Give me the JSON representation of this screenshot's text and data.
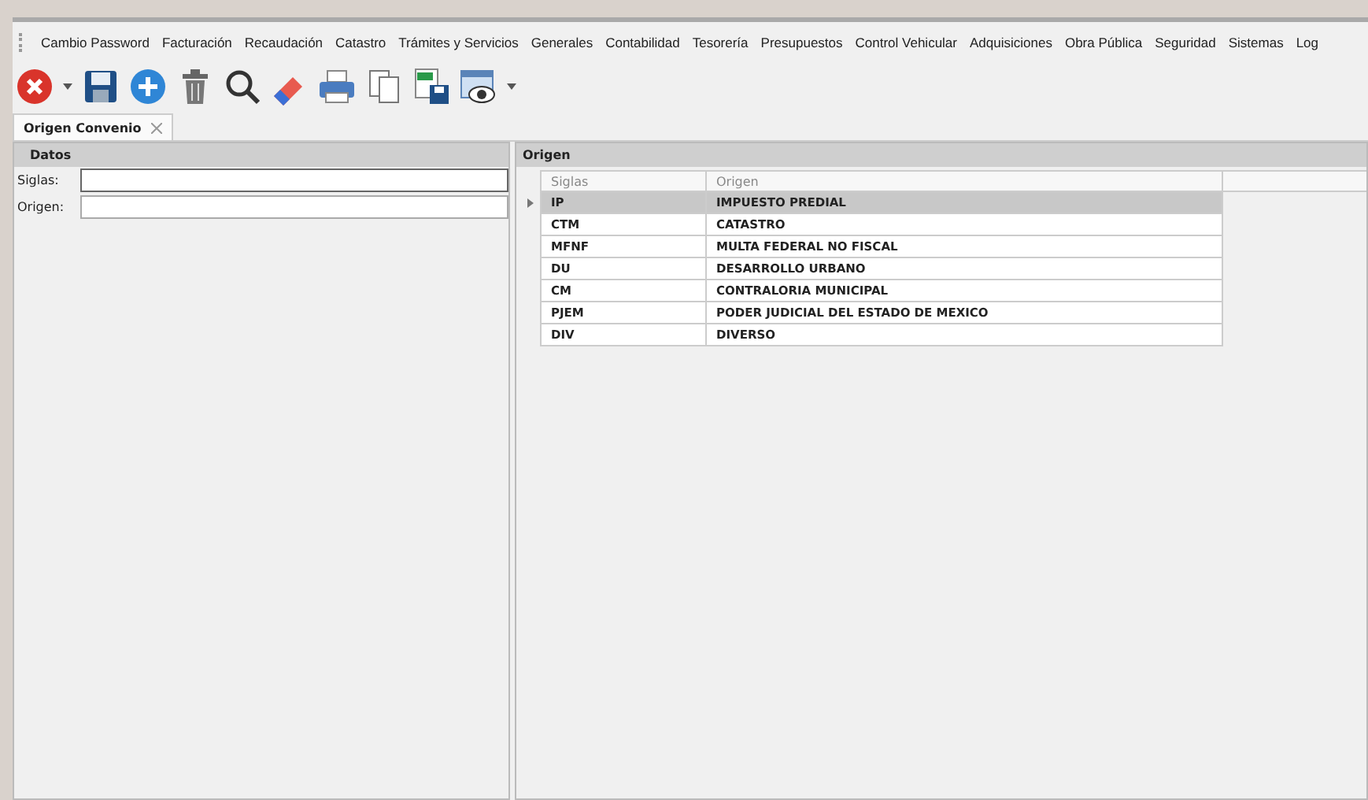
{
  "menu": [
    "Cambio Password",
    "Facturación",
    "Recaudación",
    "Catastro",
    "Trámites y Servicios",
    "Generales",
    "Contabilidad",
    "Tesorería",
    "Presupuestos",
    "Control Vehicular",
    "Adquisiciones",
    "Obra Pública",
    "Seguridad",
    "Sistemas",
    "Log"
  ],
  "tabs": [
    {
      "label": "Origen Convenio",
      "selected": true
    }
  ],
  "datos": {
    "title": "Datos",
    "fields": [
      {
        "label": "Siglas:",
        "focused": true
      },
      {
        "label": "Origen:",
        "focused": false
      }
    ]
  },
  "origen": {
    "title": "Origen",
    "columns": [
      "Siglas",
      "Origen"
    ],
    "rows": [
      {
        "siglas": "IP",
        "origen": "IMPUESTO PREDIAL",
        "selected": true
      },
      {
        "siglas": "CTM",
        "origen": "CATASTRO",
        "selected": false
      },
      {
        "siglas": "MFNF",
        "origen": "MULTA FEDERAL NO FISCAL",
        "selected": false
      },
      {
        "siglas": "DU",
        "origen": "DESARROLLO URBANO",
        "selected": false
      },
      {
        "siglas": "CM",
        "origen": "CONTRALORIA MUNICIPAL",
        "selected": false
      },
      {
        "siglas": "PJEM",
        "origen": "PODER JUDICIAL DEL ESTADO DE MEXICO",
        "selected": false
      },
      {
        "siglas": "DIV",
        "origen": "DIVERSO",
        "selected": false
      }
    ]
  }
}
